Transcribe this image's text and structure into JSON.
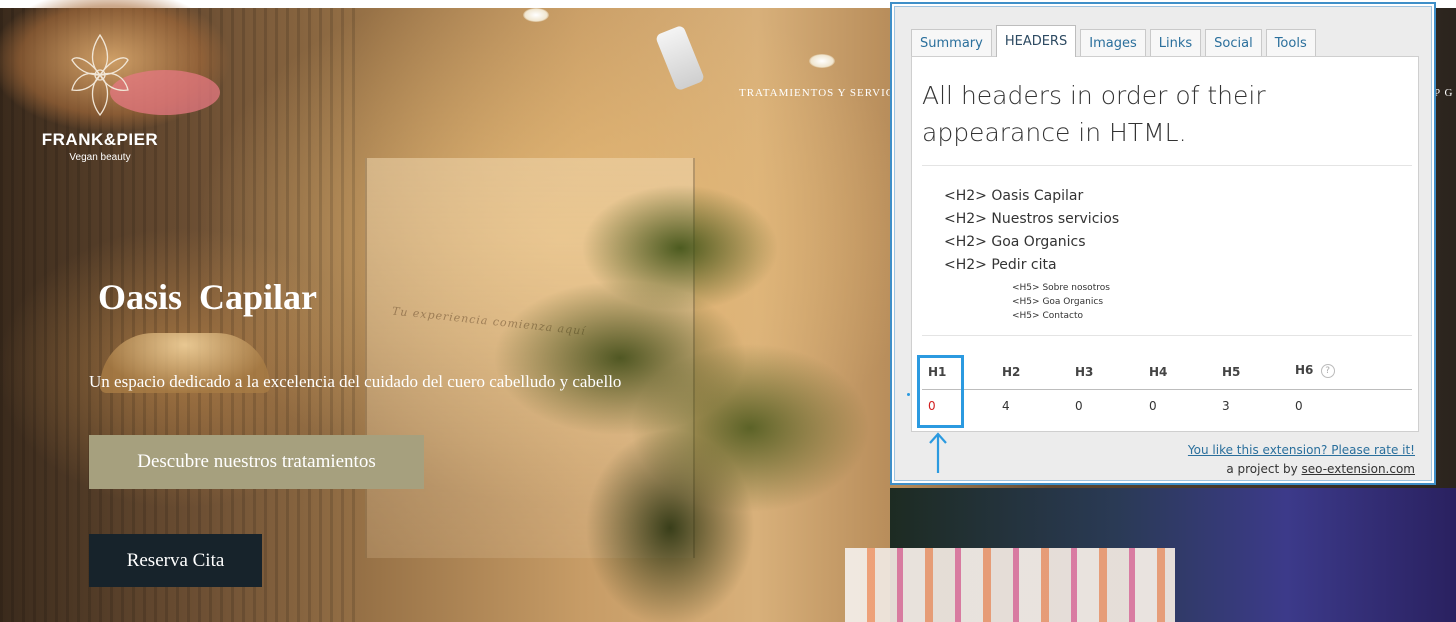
{
  "site": {
    "brand_name": "FRANK&PIER",
    "brand_tagline": "Vegan beauty",
    "nav_text": "TRATAMIENTOS Y SERVIC",
    "nav_text_right": "P G",
    "wall_script": "Tu experiencia comienza aquí",
    "hero_title": "Oasis  Capilar",
    "hero_subtitle": "Un espacio dedicado a la excelencia del cuidado del cuero cabelludo y cabello",
    "discover_button": "Descubre nuestros tratamientos",
    "reserve_button": "Reserva Cita"
  },
  "extension": {
    "tabs": [
      {
        "label": "Summary",
        "active": false
      },
      {
        "label": "HEADERS",
        "active": true
      },
      {
        "label": "Images",
        "active": false
      },
      {
        "label": "Links",
        "active": false
      },
      {
        "label": "Social",
        "active": false
      },
      {
        "label": "Tools",
        "active": false
      }
    ],
    "title": "All headers in order of their appearance in HTML.",
    "headers": [
      {
        "tag": "<H2>",
        "text": "Oasis Capilar",
        "level": 2
      },
      {
        "tag": "<H2>",
        "text": "Nuestros servicios",
        "level": 2
      },
      {
        "tag": "<H2>",
        "text": "Goa Organics",
        "level": 2
      },
      {
        "tag": "<H2>",
        "text": "Pedir cita",
        "level": 2
      },
      {
        "tag": "<H5>",
        "text": "Sobre nosotros",
        "level": 5
      },
      {
        "tag": "<H5>",
        "text": "Goa Organics",
        "level": 5
      },
      {
        "tag": "<H5>",
        "text": "Contacto",
        "level": 5
      }
    ],
    "stats": {
      "labels": [
        "H1",
        "H2",
        "H3",
        "H4",
        "H5",
        "H6"
      ],
      "values": [
        "0",
        "4",
        "0",
        "0",
        "3",
        "0"
      ],
      "help_glyph": "?"
    },
    "footer_rate": "You like this extension? Please rate it!",
    "footer_project_prefix": "a project by ",
    "footer_project_link": "seo-extension.com"
  },
  "colors": {
    "accent_blue": "#2b9ae0",
    "zero_h1_red": "#d31f1f",
    "discover_button_bg": "#a6a07e",
    "reserve_button_bg": "#17232b"
  }
}
